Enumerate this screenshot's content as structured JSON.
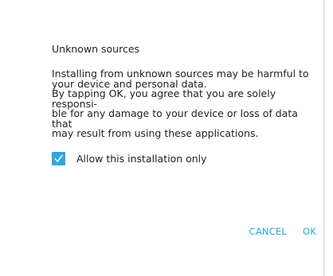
{
  "dialog": {
    "title": "Unknown sources",
    "message_lines": [
      "Installing from unknown sources may be harmful to",
      "your device and personal data.",
      "By tapping OK, you agree that you are solely responsi-",
      "ble for any damage to your device or loss of data that",
      "may result from using these applications."
    ],
    "checkbox": {
      "label": "Allow this installation only",
      "checked": true,
      "icon": "checkmark-icon",
      "color": "#2fa8d9"
    },
    "buttons": {
      "cancel_label": "CANCEL",
      "ok_label": "OK",
      "color": "#2aa6d6"
    }
  }
}
